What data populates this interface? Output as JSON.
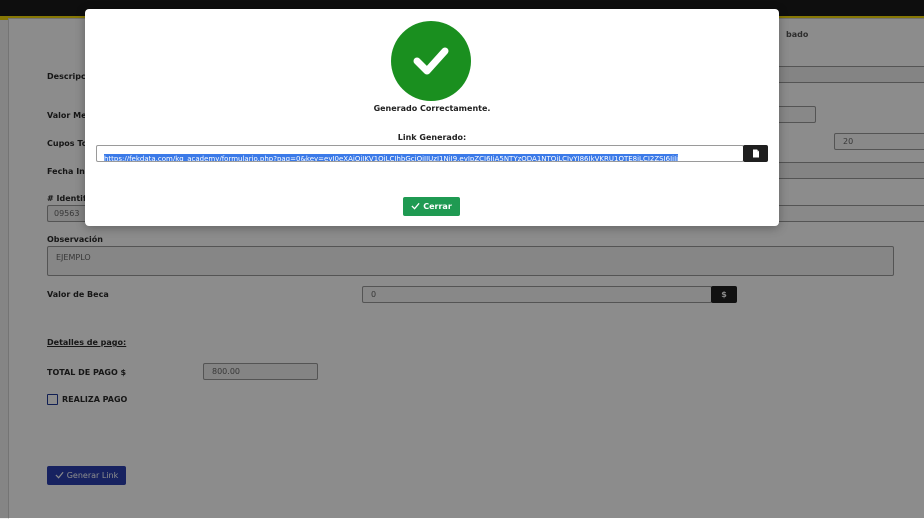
{
  "background_form": {
    "labels": {
      "descripcion": "Descripci",
      "valor_men": "Valor Me",
      "cupos": "Cupos To",
      "fecha": "Fecha Ini",
      "identificacion": "# Identifi",
      "observacion": "Observación",
      "valor_beca": "Valor de Beca",
      "detalles_pago": "Detalles de pago:",
      "total_pago": "TOTAL DE PAGO $",
      "realiza_pago": "REALIZA PAGO",
      "sabado": "bado"
    },
    "values": {
      "identificacion": "09563",
      "cupos": "20",
      "observacion": "EJEMPLO",
      "valor_beca": "0",
      "total_pago": "800.00"
    },
    "currency_symbol": "$",
    "generate_button_label": "Generar Link"
  },
  "modal": {
    "success_message": "Generado Correctamente.",
    "link_label": "Link Generado:",
    "link_value": "https://fekdata.com/kg_academy/formulario.php?pag=0&key=eyJ0eXAiOiJKV1QiLCJhbGciOiJIUzI1NiJ9.eyJpZCI6IjA5NTYzODA1NTQiLCJvYI86IkVKRU1QTE8iLCJ2ZSI6IjIi",
    "close_label": "Cerrar"
  },
  "colors": {
    "success_green": "#1a8f1f",
    "close_button": "#1f9a52",
    "generate_button": "#2a3fb0",
    "accent_yellow": "#f5d90a"
  },
  "icons": {
    "success": "check-circle-icon",
    "copy": "copy-icon",
    "close_check": "check-icon",
    "generate_check": "check-icon"
  }
}
